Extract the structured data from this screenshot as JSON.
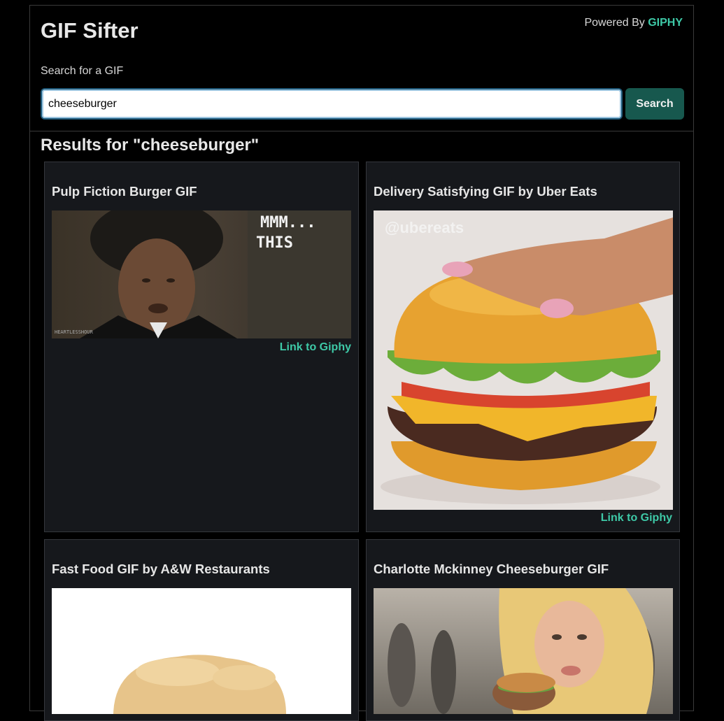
{
  "header": {
    "title": "GIF Sifter",
    "powered_by_prefix": "Powered By",
    "powered_by_brand": "GIPHY"
  },
  "search": {
    "label": "Search for a GIF",
    "value": "cheeseburger",
    "button_label": "Search"
  },
  "results": {
    "heading": "Results for \"cheeseburger\"",
    "cards": [
      {
        "title": "Pulp Fiction Burger GIF",
        "overlay_line1": "MMM...",
        "overlay_line2": "THIS",
        "watermark": "HEARTLESSHOUR",
        "link": "Link to Giphy"
      },
      {
        "title": "Delivery Satisfying GIF by Uber Eats",
        "watermark": "@ubereats",
        "link": "Link to Giphy"
      },
      {
        "title": "Fast Food GIF by A&W Restaurants"
      },
      {
        "title": "Charlotte Mckinney Cheeseburger GIF"
      }
    ]
  },
  "colors": {
    "accent": "#3ec9a7",
    "button": "#17584e",
    "card_bg": "#16181c",
    "page_bg": "#000000"
  }
}
